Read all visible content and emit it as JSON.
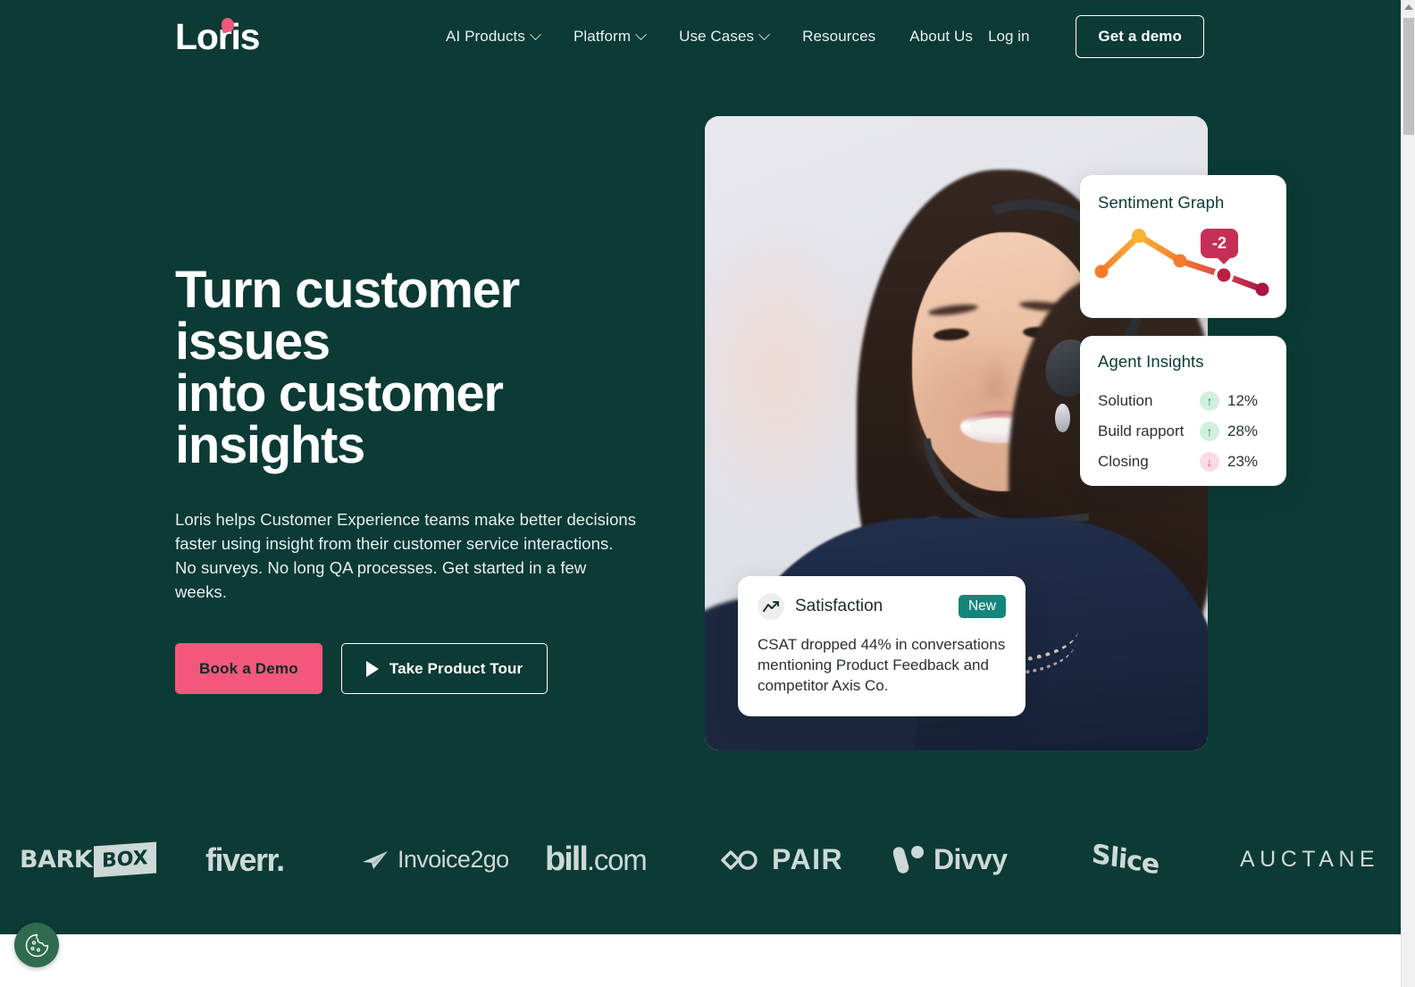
{
  "brand": {
    "name": "Loris",
    "accent_pink": "#f4577c",
    "bg_dark": "#0c3a35"
  },
  "nav": {
    "items": [
      {
        "label": "AI Products",
        "has_dropdown": true
      },
      {
        "label": "Platform",
        "has_dropdown": true
      },
      {
        "label": "Use Cases",
        "has_dropdown": true
      },
      {
        "label": "Resources",
        "has_dropdown": false
      },
      {
        "label": "About Us",
        "has_dropdown": false
      }
    ],
    "login_label": "Log in",
    "demo_label": "Get a demo"
  },
  "hero": {
    "title_line1": "Turn customer issues",
    "title_line2": "into customer",
    "title_line3": "insights",
    "subtitle_line1": "Loris helps Customer Experience teams make better decisions",
    "subtitle_line2": "faster using insight from their customer service interactions.",
    "subtitle_line3": "No surveys. No long QA processes. Get started in a few weeks.",
    "primary_cta": "Book a Demo",
    "secondary_cta": "Take Product Tour"
  },
  "cards": {
    "sentiment": {
      "title": "Sentiment Graph",
      "tooltip_value": "-2"
    },
    "agent_insights": {
      "title": "Agent Insights",
      "rows": [
        {
          "label": "Solution",
          "direction": "up",
          "arrow": "↑",
          "value": "12%"
        },
        {
          "label": "Build rapport",
          "direction": "up",
          "arrow": "↑",
          "value": "28%"
        },
        {
          "label": "Closing",
          "direction": "down",
          "arrow": "↓",
          "value": "23%"
        }
      ]
    },
    "satisfaction": {
      "title": "Satisfaction",
      "badge": "New",
      "body_line1": "CSAT dropped 44% in conversations",
      "body_line2": "mentioning Product Feedback and",
      "body_line3": "competitor Axis Co."
    }
  },
  "chart_data": {
    "type": "line",
    "title": "Sentiment Graph",
    "x": [
      0,
      1,
      2,
      3,
      4
    ],
    "values": [
      -0.2,
      1.6,
      0.2,
      -0.8,
      -1.6
    ],
    "point_colors": [
      "#f57c27",
      "#f9b233",
      "#f47a30",
      "#d8434f",
      "#a81642"
    ],
    "annotations": [
      {
        "label": "-2",
        "at_index": 3,
        "color": "#c62f55"
      }
    ],
    "highlight_index": 3,
    "grid": false,
    "xlabel": "",
    "ylabel": ""
  },
  "logos": [
    {
      "name": "BarkBox",
      "text_a": "BARK",
      "text_b": "BOX"
    },
    {
      "name": "fiverr",
      "text_a": "fiverr."
    },
    {
      "name": "Invoice2go",
      "text_a": "Invoice2go"
    },
    {
      "name": "bill.com",
      "text_a": "bill",
      "text_b": ".com"
    },
    {
      "name": "PAIR",
      "text_a": "PAIR"
    },
    {
      "name": "Divvy",
      "text_a": "Divvy"
    },
    {
      "name": "Slice",
      "text_a": "Slice"
    },
    {
      "name": "Auctane",
      "text_a": "AUCTANE"
    }
  ],
  "cookie": {
    "aria_label": "Cookie settings"
  }
}
